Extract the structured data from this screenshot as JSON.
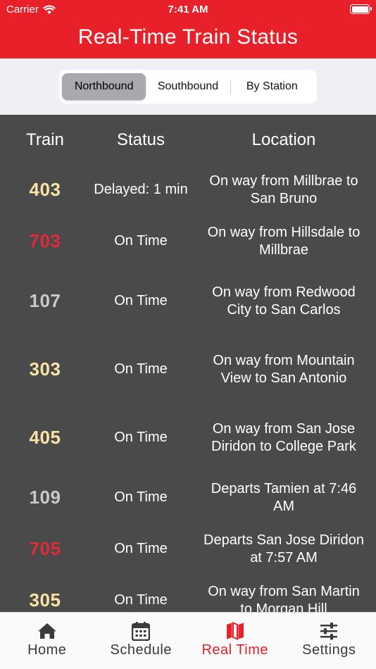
{
  "status_bar": {
    "carrier": "Carrier",
    "time": "7:41 AM"
  },
  "header": {
    "title": "Real-Time Train Status"
  },
  "segments": [
    {
      "label": "Northbound",
      "selected": true
    },
    {
      "label": "Southbound",
      "selected": false
    },
    {
      "label": "By Station",
      "selected": false
    }
  ],
  "table": {
    "headers": {
      "train": "Train",
      "status": "Status",
      "location": "Location"
    },
    "rows": [
      {
        "train": "403",
        "status": "Delayed: 1 min",
        "location": "On way from Millbrae to San Bruno",
        "train_color": "#f8e3a6"
      },
      {
        "train": "703",
        "status": "On Time",
        "location": "On way from Hillsdale to Millbrae",
        "train_color": "#e3283a"
      },
      {
        "train": "107",
        "status": "On Time",
        "location": "On way from Redwood City to San Carlos",
        "train_color": "#c9c9c9"
      },
      {
        "train": "303",
        "status": "On Time",
        "location": "On way from Mountain View to San Antonio",
        "train_color": "#f8e3a6"
      },
      {
        "train": "405",
        "status": "On Time",
        "location": "On way from San Jose Diridon to College Park",
        "train_color": "#f8e3a6"
      },
      {
        "train": "109",
        "status": "On Time",
        "location": "Departs Tamien at 7:46 AM",
        "train_color": "#c9c9c9"
      },
      {
        "train": "705",
        "status": "On Time",
        "location": "Departs San Jose Diridon at 7:57 AM",
        "train_color": "#e3283a"
      },
      {
        "train": "305",
        "status": "On Time",
        "location": "On way from San Martin to Morgan Hill",
        "train_color": "#f8e3a6"
      }
    ]
  },
  "tabbar": {
    "tabs": [
      {
        "label": "Home",
        "icon": "house-icon",
        "active": false
      },
      {
        "label": "Schedule",
        "icon": "calendar-icon",
        "active": false
      },
      {
        "label": "Real Time",
        "icon": "map-icon",
        "active": true
      },
      {
        "label": "Settings",
        "icon": "sliders-icon",
        "active": false
      }
    ],
    "active_color": "#e8202a",
    "inactive_color": "#3a3a3c"
  },
  "colors": {
    "header_bg": "#e8202a",
    "table_bg": "#4a4a4a",
    "segment_bg": "#efeff4"
  }
}
